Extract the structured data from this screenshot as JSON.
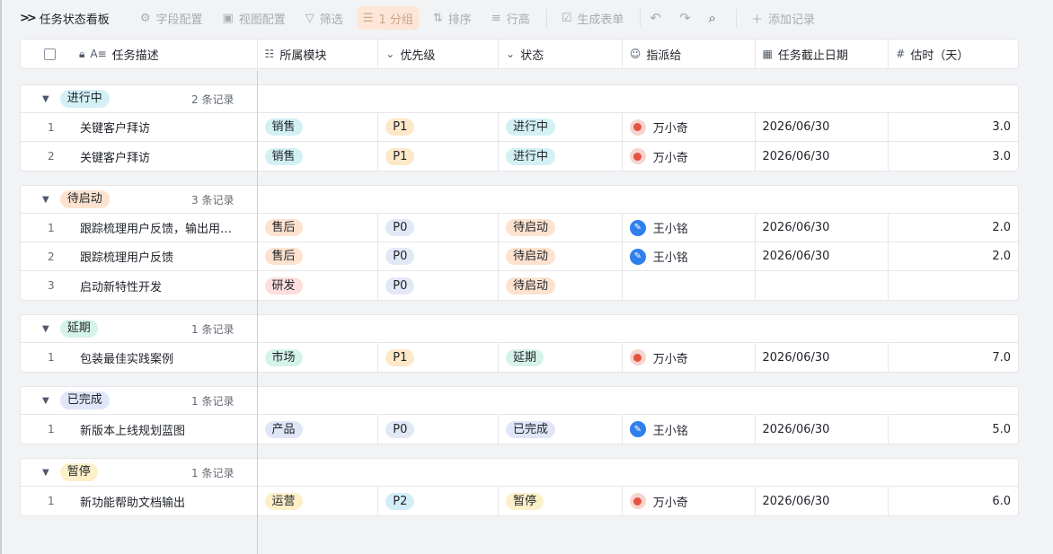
{
  "toolbar": {
    "title": "任务状态看板",
    "items": [
      {
        "label": "字段配置",
        "icon": "gear-icon"
      },
      {
        "label": "视图配置",
        "icon": "view-config-icon"
      },
      {
        "label": "筛选",
        "icon": "filter-icon"
      },
      {
        "label": "1 分组",
        "icon": "group-icon"
      },
      {
        "label": "排序",
        "icon": "sort-icon"
      },
      {
        "label": "行高",
        "icon": "row-height-icon"
      },
      {
        "label": "生成表单",
        "icon": "form-icon"
      }
    ],
    "add_record": "添加记录"
  },
  "columns": [
    "任务描述",
    "所属模块",
    "优先级",
    "状态",
    "指派给",
    "任务截止日期",
    "估时（天）"
  ],
  "colors": {
    "sales": "#d3f1f5",
    "after_sales": "#fde3cf",
    "rd": "#fcdede",
    "market": "#d6f3e9",
    "product": "#e0e6f8",
    "ops": "#fdf0c8",
    "p0": "#e3e8f7",
    "p1": "#fde8c8",
    "p2": "#d3eef8",
    "in_progress": "#d3f1f5",
    "pending": "#fde3cf",
    "delayed": "#d6f3e9",
    "done": "#e0e6f8",
    "paused": "#fdf0c8"
  },
  "groups": [
    {
      "name": "进行中",
      "count": "2 条记录",
      "color": "#d3f1f5",
      "rows": [
        {
          "idx": "1",
          "desc": "关键客户拜访",
          "module": "销售",
          "module_color": "#d3f1f5",
          "priority": "P1",
          "priority_color": "#fde8c8",
          "status": "进行中",
          "status_color": "#d3f1f5",
          "assignee": "万小奇",
          "avatar": "red",
          "date": "2026/06/30",
          "est": "3.0"
        },
        {
          "idx": "2",
          "desc": "关键客户拜访",
          "module": "销售",
          "module_color": "#d3f1f5",
          "priority": "P1",
          "priority_color": "#fde8c8",
          "status": "进行中",
          "status_color": "#d3f1f5",
          "assignee": "万小奇",
          "avatar": "red",
          "date": "2026/06/30",
          "est": "3.0"
        }
      ]
    },
    {
      "name": "待启动",
      "count": "3 条记录",
      "color": "#fde3cf",
      "rows": [
        {
          "idx": "1",
          "desc": "跟踪梳理用户反馈，输出用…",
          "module": "售后",
          "module_color": "#fde3cf",
          "priority": "P0",
          "priority_color": "#e3e8f7",
          "status": "待启动",
          "status_color": "#fde3cf",
          "assignee": "王小铭",
          "avatar": "blue",
          "date": "2026/06/30",
          "est": "2.0"
        },
        {
          "idx": "2",
          "desc": "跟踪梳理用户反馈",
          "module": "售后",
          "module_color": "#fde3cf",
          "priority": "P0",
          "priority_color": "#e3e8f7",
          "status": "待启动",
          "status_color": "#fde3cf",
          "assignee": "王小铭",
          "avatar": "blue",
          "date": "2026/06/30",
          "est": "2.0"
        },
        {
          "idx": "3",
          "desc": "启动新特性开发",
          "module": "研发",
          "module_color": "#fcdede",
          "priority": "P0",
          "priority_color": "#e3e8f7",
          "status": "待启动",
          "status_color": "#fde3cf",
          "assignee": "",
          "avatar": "",
          "date": "",
          "est": ""
        }
      ]
    },
    {
      "name": "延期",
      "count": "1 条记录",
      "color": "#d6f3e9",
      "rows": [
        {
          "idx": "1",
          "desc": "包装最佳实践案例",
          "module": "市场",
          "module_color": "#d6f3e9",
          "priority": "P1",
          "priority_color": "#fde8c8",
          "status": "延期",
          "status_color": "#d6f3e9",
          "assignee": "万小奇",
          "avatar": "red",
          "date": "2026/06/30",
          "est": "7.0"
        }
      ]
    },
    {
      "name": "已完成",
      "count": "1 条记录",
      "color": "#e0e6f8",
      "rows": [
        {
          "idx": "1",
          "desc": "新版本上线规划蓝图",
          "module": "产品",
          "module_color": "#e0e6f8",
          "priority": "P0",
          "priority_color": "#e3e8f7",
          "status": "已完成",
          "status_color": "#e0e6f8",
          "assignee": "王小铭",
          "avatar": "blue",
          "date": "2026/06/30",
          "est": "5.0"
        }
      ]
    },
    {
      "name": "暂停",
      "count": "1 条记录",
      "color": "#fdf0c8",
      "rows": [
        {
          "idx": "1",
          "desc": "新功能帮助文档输出",
          "module": "运营",
          "module_color": "#fdf0c8",
          "priority": "P2",
          "priority_color": "#d3eef8",
          "status": "暂停",
          "status_color": "#fdf0c8",
          "assignee": "万小奇",
          "avatar": "red",
          "date": "2026/06/30",
          "est": "6.0"
        }
      ]
    }
  ]
}
